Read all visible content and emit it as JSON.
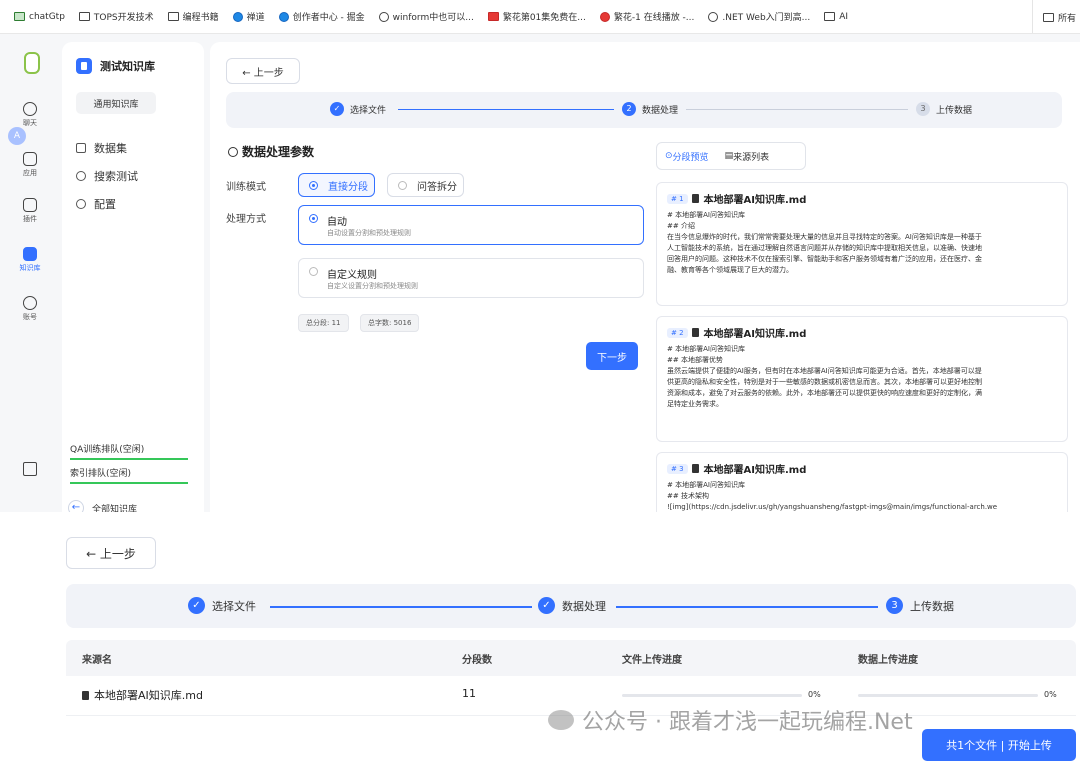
{
  "bookmarks": [
    {
      "label": "chatGtp",
      "icon": "chatgpt-icon"
    },
    {
      "label": "TOPS开发技术",
      "icon": "folder-icon"
    },
    {
      "label": "编程书籍",
      "icon": "folder-icon"
    },
    {
      "label": "禅道",
      "icon": "zentao-icon"
    },
    {
      "label": "创作者中心 - 掘金",
      "icon": "juejin-icon"
    },
    {
      "label": "winform中也可以...",
      "icon": "site-icon"
    },
    {
      "label": "繁花第01集免费在...",
      "icon": "netflix-icon"
    },
    {
      "label": "繁花-1 在线播放 -...",
      "icon": "video-icon"
    },
    {
      "label": ".NET Web入门到高...",
      "icon": "site-icon"
    },
    {
      "label": "AI",
      "icon": "folder-icon"
    }
  ],
  "bookmarks_right": "所有",
  "rail": [
    {
      "label": "聊天",
      "icon": "chat-icon"
    },
    {
      "label": "应用",
      "icon": "robot-icon"
    },
    {
      "label": "插件",
      "icon": "plugin-icon"
    },
    {
      "label": "知识库",
      "icon": "database-icon",
      "active": true
    },
    {
      "label": "账号",
      "icon": "user-icon"
    }
  ],
  "avatar_letter": "A",
  "sidebar": {
    "kb_name": "测试知识库",
    "kb_type": "通用知识库",
    "nav": [
      "数据集",
      "搜索测试",
      "配置"
    ],
    "queue_qa": "QA训练排队(空闲)",
    "queue_index": "索引排队(空闲)",
    "back_all": "全部知识库"
  },
  "main": {
    "back_label": "← 上一步",
    "steps": [
      "选择文件",
      "数据处理",
      "上传数据"
    ],
    "step3_num": "3",
    "section_title": "数据处理参数",
    "train_mode_label": "训练模式",
    "train_modes": [
      "直接分段",
      "问答拆分"
    ],
    "process_label": "处理方式",
    "process_options": [
      {
        "title": "自动",
        "desc": "自动设置分割和预处理规则"
      },
      {
        "title": "自定义规则",
        "desc": "自定义设置分割和预处理规则"
      }
    ],
    "total_chunks": "总分段: 11",
    "total_chars": "总字数: 5016",
    "next_label": "下一步",
    "preview_tabs": [
      "分段预览",
      "来源列表"
    ],
    "chunks": [
      {
        "idx": "# 1",
        "title": "本地部署AI知识库.md",
        "lines": [
          "# 本地部署AI问答知识库",
          "## 介绍",
          "在当今信息爆炸的时代，我们常常需要处理大量的信息并且寻找特定的答案。AI问答知识库是一种基于",
          "人工智能技术的系统，旨在通过理解自然语言问题并从存储的知识库中提取相关信息，以准确、快速地",
          "回答用户的问题。这种技术不仅在搜索引擎、智能助手和客户服务领域有着广泛的应用，还在医疗、金",
          "融、教育等各个领域展现了巨大的潜力。"
        ]
      },
      {
        "idx": "# 2",
        "title": "本地部署AI知识库.md",
        "lines": [
          "# 本地部署AI问答知识库",
          "## 本地部署优势",
          "虽然云端提供了便捷的AI服务，但有时在本地部署AI问答知识库可能更为合适。首先，本地部署可以提",
          "供更高的隐私和安全性，特别是对于一些敏感的数据或机密信息而言。其次，本地部署可以更好地控制",
          "资源和成本，避免了对云服务的依赖。此外，本地部署还可以提供更快的响应速度和更好的定制化，满",
          "足特定业务需求。"
        ]
      },
      {
        "idx": "# 3",
        "title": "本地部署AI知识库.md",
        "lines": [
          "# 本地部署AI问答知识库",
          "## 技术架构",
          "![img](https://cdn.jsdelivr.us/gh/yangshuansheng/fastgpt-imgs@main/imgs/functional-arch.we"
        ]
      }
    ]
  },
  "bottom": {
    "back_label": "← 上一步",
    "steps": [
      "选择文件",
      "数据处理",
      "上传数据"
    ],
    "step3_num": "3",
    "columns": [
      "来源名",
      "分段数",
      "文件上传进度",
      "数据上传进度"
    ],
    "rows": [
      {
        "name": "本地部署AI知识库.md",
        "chunks": "11",
        "file_progress_text": "0%",
        "data_progress_text": "0%",
        "file_progress": 0,
        "data_progress": 0
      }
    ],
    "upload_label": "共1个文件 | 开始上传"
  },
  "watermark": "公众号 · 跟着才浅一起玩编程.Net",
  "colors": {
    "accent": "#3370ff",
    "queue_bar": "#35c759"
  }
}
